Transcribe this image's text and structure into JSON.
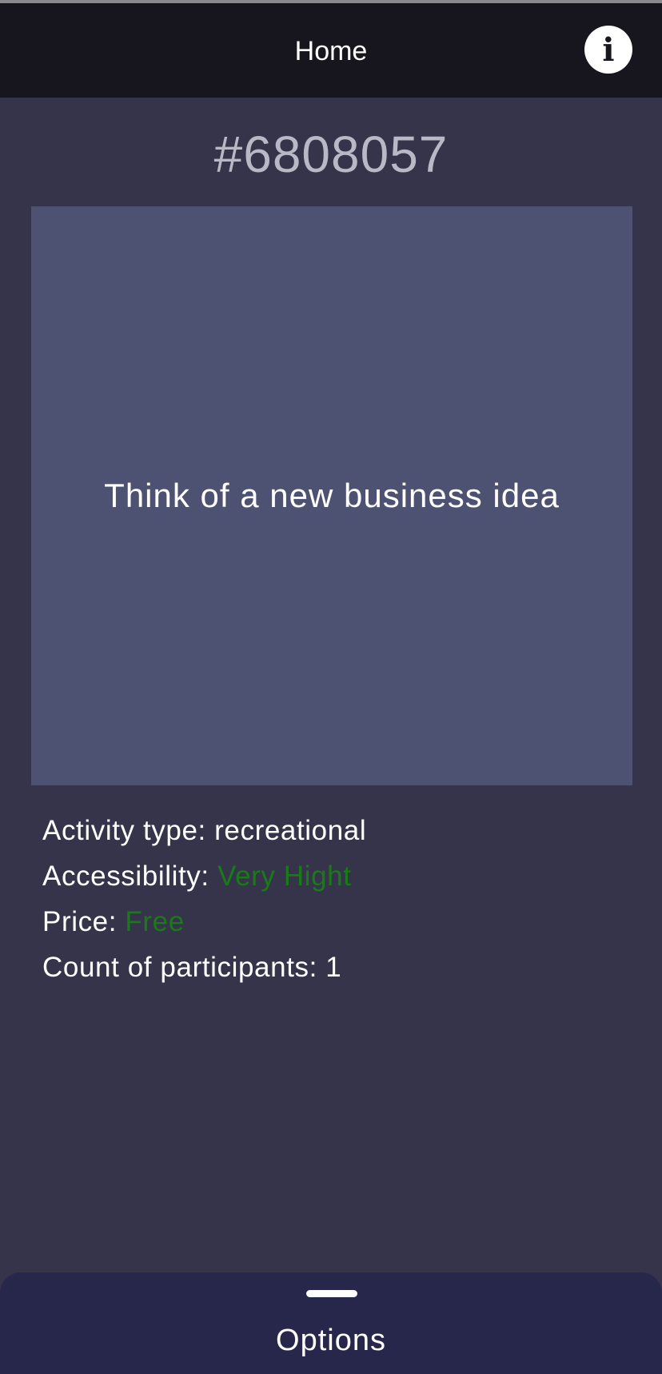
{
  "app_bar": {
    "title": "Home",
    "info_icon": "info-icon"
  },
  "activity": {
    "id": "#6808057",
    "title": "Think of a new business idea",
    "details": [
      {
        "label": "Activity type: ",
        "value": "recreational"
      },
      {
        "label": "Accessibility: ",
        "value": "Very Hight",
        "value_color": "#197a17"
      },
      {
        "label": "Price: ",
        "value": "Free",
        "value_color": "#197a17"
      },
      {
        "label": "Count of participants: ",
        "value": "1"
      }
    ]
  },
  "bottom_sheet": {
    "title": "Options"
  },
  "colors": {
    "background": "#35344a",
    "app_bar": "#17161f",
    "card": "#4e5272",
    "bottom_sheet": "#27264b",
    "positive_value": "#197a17"
  }
}
